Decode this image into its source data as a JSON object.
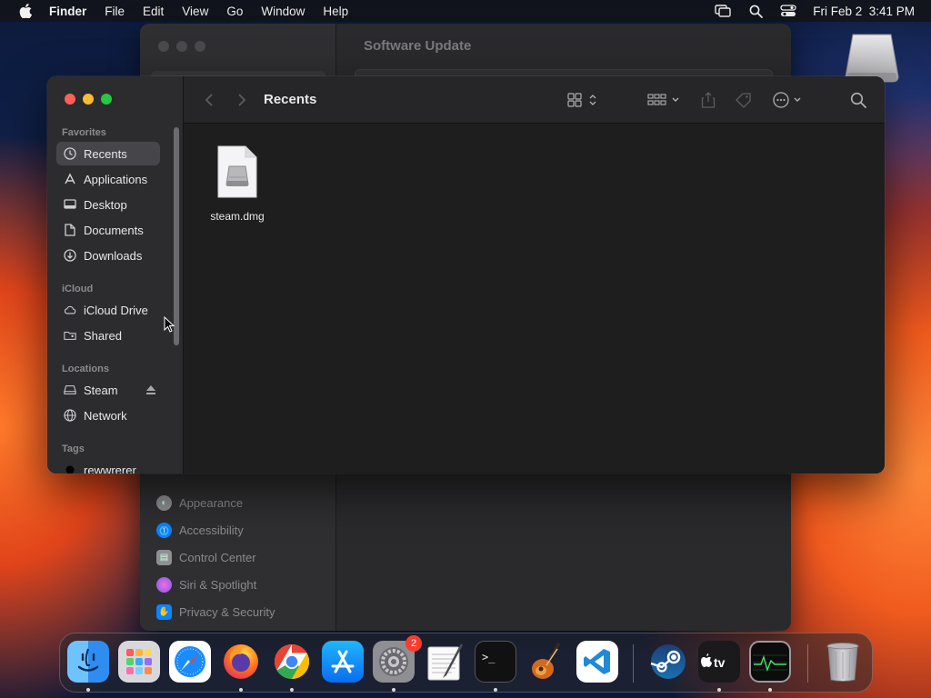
{
  "menubar": {
    "app_name": "Finder",
    "menus": [
      "File",
      "Edit",
      "View",
      "Go",
      "Window",
      "Help"
    ],
    "clock": "Fri Feb 2  3:41 PM"
  },
  "background_window": {
    "title": "Software Update",
    "sidebar_items": [
      {
        "label": "Appearance",
        "icon": "appearance-icon",
        "color": "#8e8e93"
      },
      {
        "label": "Accessibility",
        "icon": "accessibility-icon",
        "color": "#0a84ff"
      },
      {
        "label": "Control Center",
        "icon": "control-center-icon",
        "color": "#8e8e93"
      },
      {
        "label": "Siri & Spotlight",
        "icon": "siri-icon",
        "color": "#bf5af2"
      },
      {
        "label": "Privacy & Security",
        "icon": "hand-icon",
        "color": "#0a84ff"
      }
    ]
  },
  "finder": {
    "title": "Recents",
    "sidebar": {
      "favorites_header": "Favorites",
      "favorites": [
        {
          "label": "Recents",
          "icon": "clock-icon",
          "selected": true
        },
        {
          "label": "Applications",
          "icon": "applications-icon",
          "selected": false
        },
        {
          "label": "Desktop",
          "icon": "desktop-icon",
          "selected": false
        },
        {
          "label": "Documents",
          "icon": "document-icon",
          "selected": false
        },
        {
          "label": "Downloads",
          "icon": "download-icon",
          "selected": false
        }
      ],
      "icloud_header": "iCloud",
      "icloud": [
        {
          "label": "iCloud Drive",
          "icon": "cloud-icon"
        },
        {
          "label": "Shared",
          "icon": "shared-folder-icon"
        }
      ],
      "locations_header": "Locations",
      "locations": [
        {
          "label": "Steam",
          "icon": "drive-icon",
          "ejectable": true
        },
        {
          "label": "Network",
          "icon": "network-icon",
          "ejectable": false
        }
      ],
      "tags_header": "Tags",
      "tags": [
        {
          "label": "rewwrerer",
          "color": "#111111"
        }
      ]
    },
    "files": [
      {
        "name": "steam.dmg",
        "icon": "disk-image-icon"
      }
    ]
  },
  "dock": {
    "apps": [
      {
        "name": "Finder",
        "icon": "finder-icon",
        "running": true
      },
      {
        "name": "Launchpad",
        "icon": "launchpad-icon",
        "running": false
      },
      {
        "name": "Safari",
        "icon": "safari-icon",
        "running": false
      },
      {
        "name": "Firefox",
        "icon": "firefox-icon",
        "running": true
      },
      {
        "name": "Chrome",
        "icon": "chrome-icon",
        "running": true
      },
      {
        "name": "App Store",
        "icon": "app-store-icon",
        "running": false
      },
      {
        "name": "System Settings",
        "icon": "system-settings-icon",
        "running": true,
        "badge": "2"
      },
      {
        "name": "TextEdit",
        "icon": "textedit-icon",
        "running": false
      },
      {
        "name": "Terminal",
        "icon": "terminal-icon",
        "running": true
      },
      {
        "name": "GarageBand",
        "icon": "garageband-icon",
        "running": false
      },
      {
        "name": "Visual Studio Code",
        "icon": "vscode-icon",
        "running": false
      },
      {
        "name": "Steam",
        "icon": "steam-icon",
        "running": false
      },
      {
        "name": "Apple TV",
        "icon": "apple-tv-icon",
        "running": true
      },
      {
        "name": "Activity Monitor",
        "icon": "activity-monitor-icon",
        "running": true
      },
      {
        "name": "Trash",
        "icon": "trash-icon",
        "running": false
      }
    ]
  }
}
